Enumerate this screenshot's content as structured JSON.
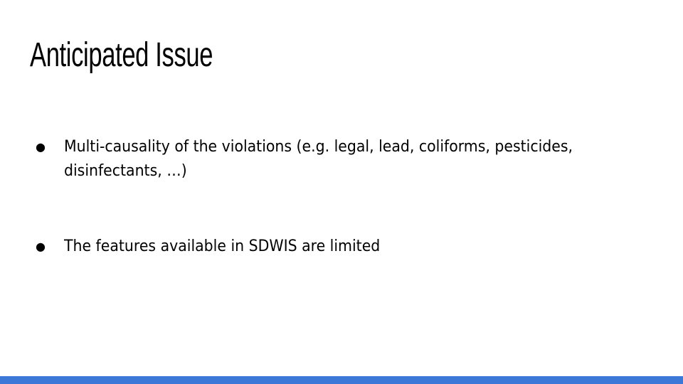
{
  "slide": {
    "title": "Anticipated Issue",
    "bullets": [
      {
        "marker": "●",
        "text": "Multi-causality of the violations (e.g. legal, lead, coliforms, pesticides, disinfectants, …)"
      },
      {
        "marker": "●",
        "text": "The features available in SDWIS are limited"
      }
    ]
  },
  "colors": {
    "background": "#ffffff",
    "text": "#000000",
    "accent_bar": "#3c78d8"
  }
}
